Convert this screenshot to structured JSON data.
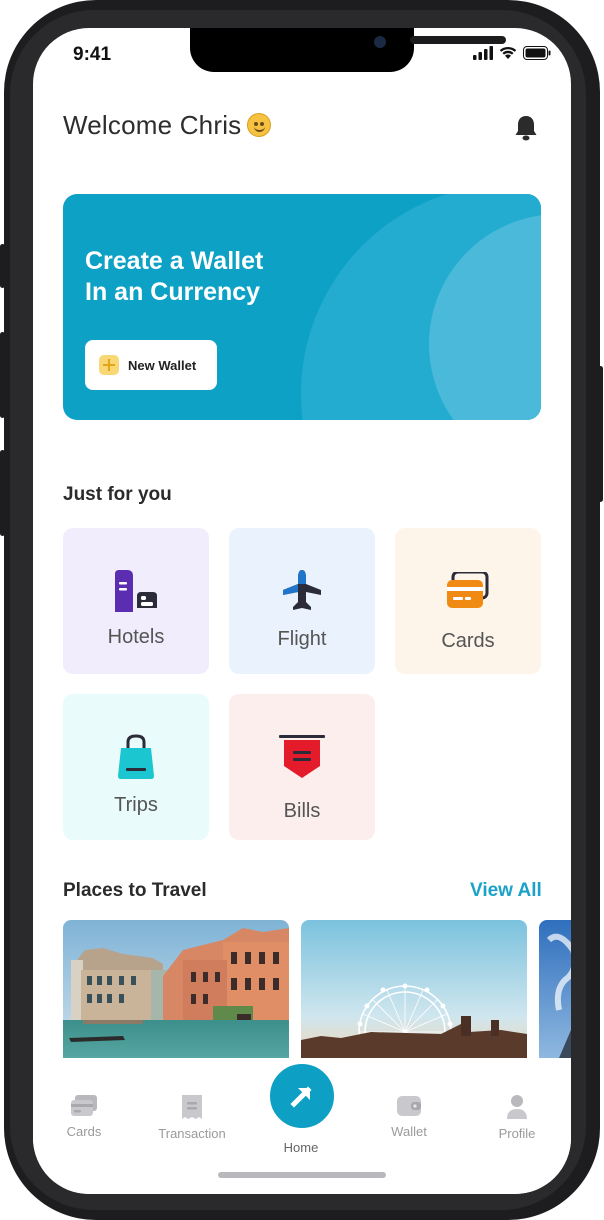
{
  "status_bar": {
    "time": "9:41"
  },
  "header": {
    "greeting": "Welcome Chris"
  },
  "banner": {
    "title_line1": "Create a Wallet",
    "title_line2": "In an Currency",
    "button_label": "New Wallet"
  },
  "just_for_you": {
    "title": "Just for you",
    "items": [
      {
        "label": "Hotels",
        "icon": "hotel-icon",
        "bg": "#f1edfd",
        "color": "#5b2db0"
      },
      {
        "label": "Flight",
        "icon": "plane-icon",
        "bg": "#eaf3fd",
        "color": "#1f75c9"
      },
      {
        "label": "Cards",
        "icon": "card-icon",
        "bg": "#fdf4ea",
        "color": "#f08a12"
      },
      {
        "label": "Trips",
        "icon": "bag-icon",
        "bg": "#eafbfb",
        "color": "#1cc6d0"
      },
      {
        "label": "Bills",
        "icon": "bill-icon",
        "bg": "#fdeeee",
        "color": "#e41b2b"
      }
    ]
  },
  "places": {
    "title": "Places to Travel",
    "view_all": "View All"
  },
  "bottom_nav": {
    "items": [
      {
        "label": "Cards",
        "icon": "cards-icon"
      },
      {
        "label": "Transaction",
        "icon": "receipt-icon"
      },
      {
        "label": "Home",
        "icon": "arrow-icon"
      },
      {
        "label": "Wallet",
        "icon": "wallet-icon"
      },
      {
        "label": "Profile",
        "icon": "user-icon"
      }
    ],
    "accent": "#0e9fc4"
  }
}
